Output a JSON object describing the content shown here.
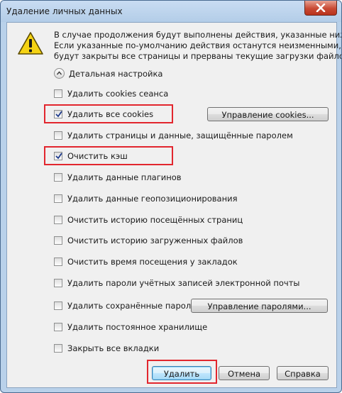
{
  "window": {
    "title": "Удаление личных данных"
  },
  "description": [
    "В случае продолжения будут выполнены действия, указанные ниже.",
    "Если указанные по-умолчанию действия останутся неизменными,",
    "будут закрыты все страницы и прерваны текущие загрузки файлов."
  ],
  "detail_toggle": {
    "label": "Детальная настройка"
  },
  "options": [
    {
      "label": "Удалить cookies сеанса",
      "checked": false
    },
    {
      "label": "Удалить все cookies",
      "checked": true
    },
    {
      "label": "Удалить страницы и данные, защищённые паролем",
      "checked": false
    },
    {
      "label": "Очистить кэш",
      "checked": true
    },
    {
      "label": "Удалить данные плагинов",
      "checked": false
    },
    {
      "label": "Удалить данные геопозиционирования",
      "checked": false
    },
    {
      "label": "Очистить историю посещённых страниц",
      "checked": false
    },
    {
      "label": "Очистить историю загруженных файлов",
      "checked": false
    },
    {
      "label": "Очистить время посещения у закладок",
      "checked": false
    },
    {
      "label": "Удалить пароли учётных записей электронной почты",
      "checked": false
    },
    {
      "label": "Удалить сохранённые пароли",
      "checked": false
    },
    {
      "label": "Удалить постоянное хранилище",
      "checked": false
    },
    {
      "label": "Закрыть все вкладки",
      "checked": false
    }
  ],
  "buttons": {
    "manage_cookies": "Управление cookies...",
    "manage_passwords": "Управление паролями...",
    "delete": "Удалить",
    "cancel": "Отмена",
    "help": "Справка"
  },
  "colors": {
    "highlight": "#e2262e",
    "title_bar": "#b9d1ea",
    "client": "#f0f0f0"
  },
  "icons": {
    "warning": "warning-triangle-icon",
    "close": "close-icon",
    "expander": "chevron-up-icon"
  }
}
